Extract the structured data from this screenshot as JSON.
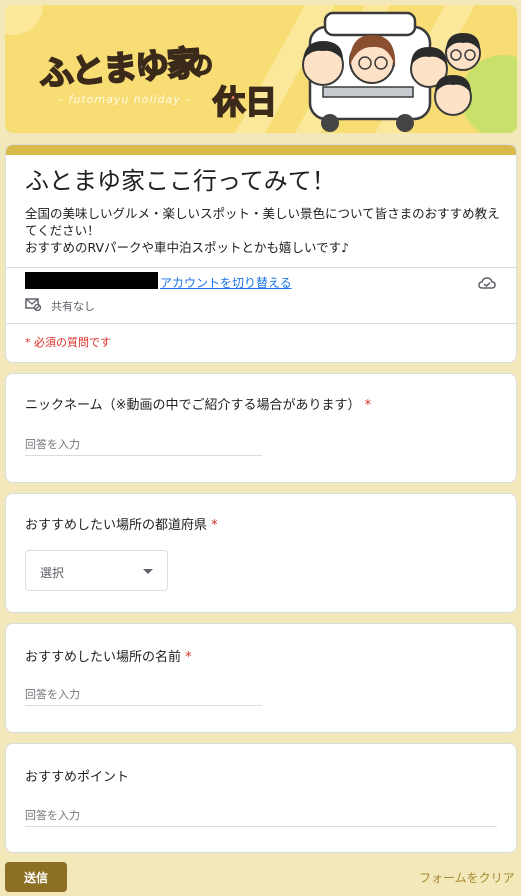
{
  "banner": {
    "title": "ふとまゆ家",
    "no": "の",
    "kyujitsu": "休日",
    "subtitle": "- futomayu holiday -"
  },
  "form": {
    "title": "ふとまゆ家ここ行ってみて！",
    "description_line1": "全国の美味しいグルメ・楽しいスポット・美しい景色について皆さまのおすすめ教えてください！",
    "description_line2": "おすすめのRVパークや車中泊スポットとかも嬉しいです♪",
    "switch_account": "アカウントを切り替える",
    "not_shared": "共有なし",
    "required_note": "* 必須の質問です"
  },
  "questions": [
    {
      "label": "ニックネーム（※動画の中でご紹介する場合があります）",
      "required": "*",
      "placeholder": "回答を入力"
    },
    {
      "label": "おすすめしたい場所の都道府県",
      "required": "*",
      "select_value": "選択"
    },
    {
      "label": "おすすめしたい場所の名前",
      "required": "*",
      "placeholder": "回答を入力"
    },
    {
      "label": "おすすめポイント",
      "placeholder": "回答を入力"
    }
  ],
  "footer": {
    "submit": "送信",
    "clear": "フォームをクリア"
  },
  "colors": {
    "page_bg": "#f3e8b9",
    "accent": "#d8b94a",
    "submit_bg": "#8c6f23",
    "required": "#d93025",
    "link": "#1a73e8"
  }
}
